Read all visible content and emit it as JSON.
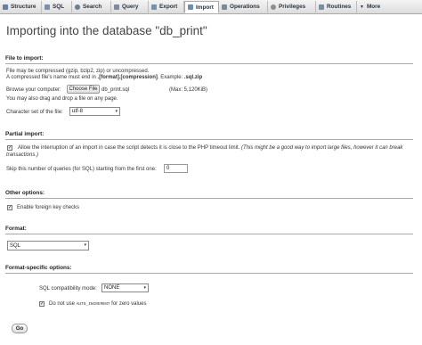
{
  "tabs": [
    {
      "label": "Structure",
      "icon": "structure-icon",
      "color": "#6a7f99"
    },
    {
      "label": "SQL",
      "icon": "sql-icon",
      "color": "#7b8fa8"
    },
    {
      "label": "Search",
      "icon": "search-icon",
      "color": "#6d7e94"
    },
    {
      "label": "Query",
      "icon": "query-icon",
      "color": "#7d8aa0"
    },
    {
      "label": "Export",
      "icon": "export-icon",
      "color": "#7591b0"
    },
    {
      "label": "Import",
      "icon": "import-icon",
      "color": "#6f8cb0"
    },
    {
      "label": "Operations",
      "icon": "wrench-icon",
      "color": "#808a96"
    },
    {
      "label": "Privileges",
      "icon": "users-icon",
      "color": "#8e8e8e"
    },
    {
      "label": "Routines",
      "icon": "routines-icon",
      "color": "#7a8da6"
    },
    {
      "label": "More",
      "icon": "chevron-down-icon",
      "color": "#555555"
    }
  ],
  "title": "Importing into the database \"db_print\"",
  "file_section": {
    "legend": "File to import:",
    "line1": "File may be compressed (gzip, bzip2, zip) or uncompressed.",
    "line2_prefix": "A compressed file's name must end in ",
    "line2_format": ".[format].[compression]",
    "line2_mid": ". Example: ",
    "line2_example": ".sql.zip",
    "browse_label": "Browse your computer:",
    "choose_button": "Choose File",
    "filename": "db_print.sql",
    "max_size": "(Max: 5,120KiB)",
    "drag_hint": "You may also drag and drop a file on any page.",
    "charset_label": "Character set of the file:",
    "charset_value": "utf-8"
  },
  "partial_section": {
    "legend": "Partial import:",
    "interrupt_text": "Allow the interruption of an import in case the script detects it is close to the PHP timeout limit.",
    "interrupt_note_1": "(This might be a good way to import large files, however it can break",
    "interrupt_note_2": "transactions.)",
    "skip_label": "Skip this number of queries (for SQL) starting from the first one:",
    "skip_value": "0"
  },
  "other_section": {
    "legend": "Other options:",
    "foreign_key_label": "Enable foreign key checks"
  },
  "format_section": {
    "legend": "Format:",
    "format_value": "SQL"
  },
  "format_specific": {
    "legend": "Format-specific options:",
    "compat_label": "SQL compatibility mode:",
    "compat_value": "NONE",
    "auto_prefix": "Do not use ",
    "auto_code": "AUTO_INCREMENT",
    "auto_suffix": " for zero values"
  },
  "go_button": "Go"
}
